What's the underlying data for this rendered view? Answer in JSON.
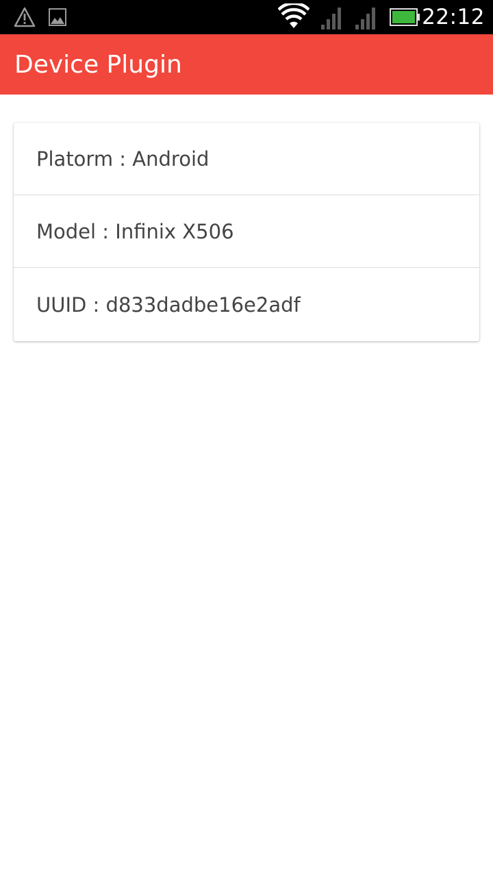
{
  "status_bar": {
    "time": "22:12",
    "icons": [
      "warning-icon",
      "image-notification-icon",
      "wifi-icon",
      "signal-icon",
      "signal-icon",
      "battery-icon"
    ],
    "battery_color": "#3db83d"
  },
  "app_bar": {
    "title": "Device Plugin",
    "color": "#f2473c"
  },
  "device_info": {
    "items": [
      {
        "label": "Platorm : Android"
      },
      {
        "label": "Model : Infinix X506"
      },
      {
        "label": "UUID : d833dadbe16e2adf"
      }
    ]
  }
}
